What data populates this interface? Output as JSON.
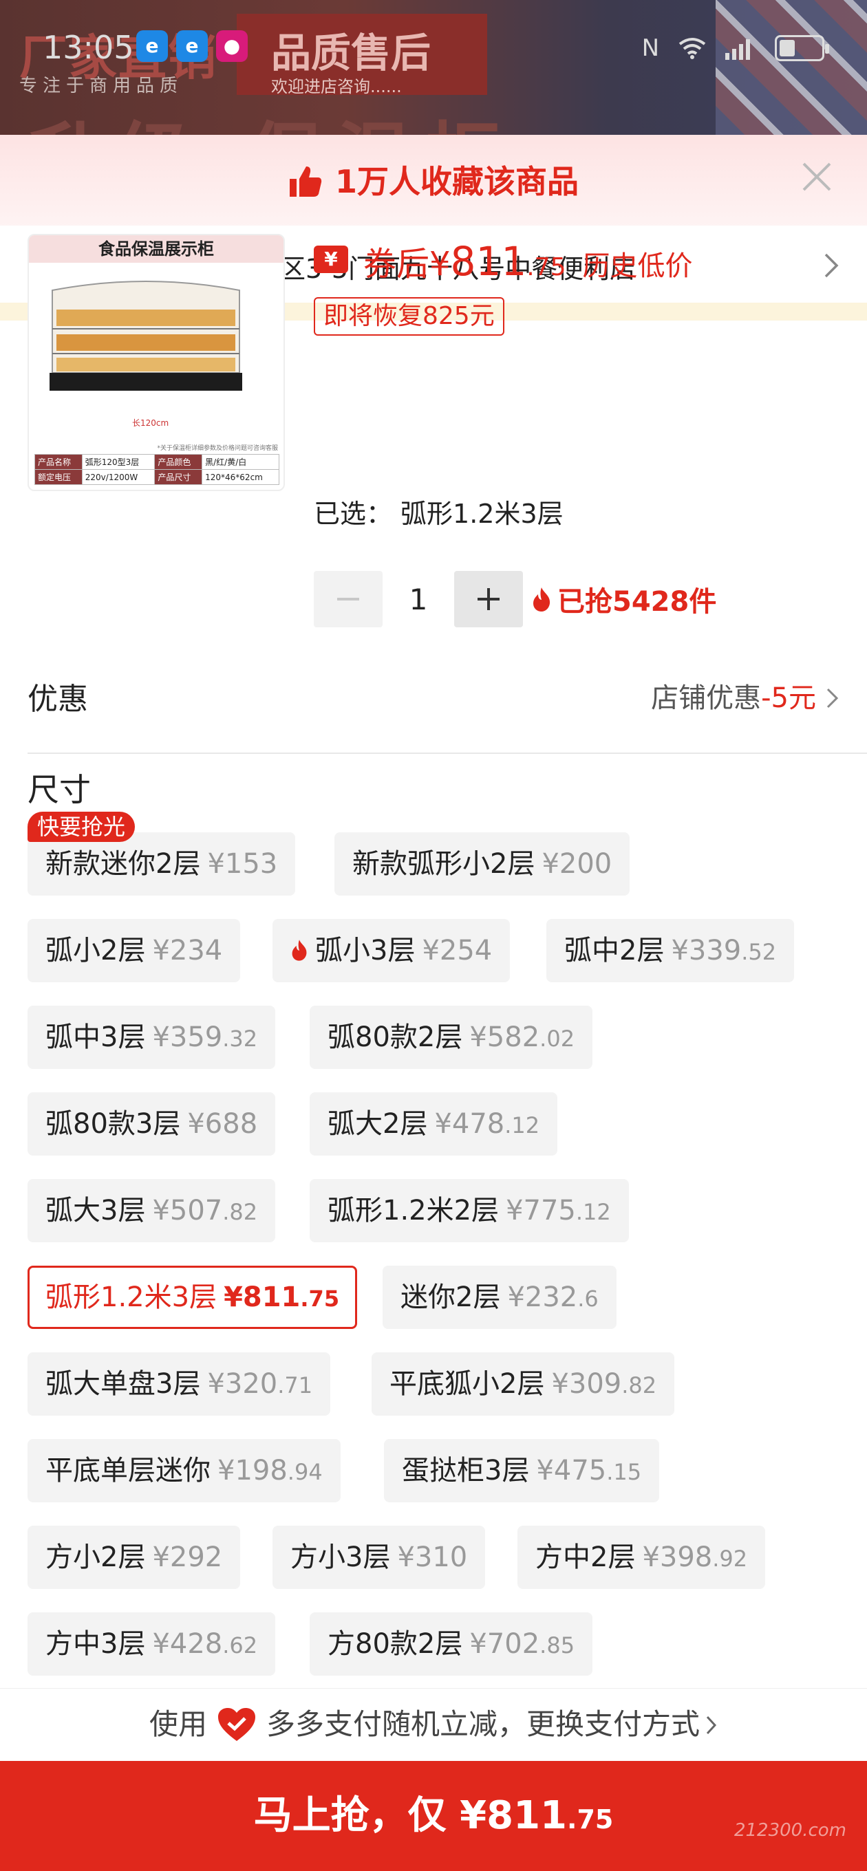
{
  "background": {
    "brand": "厂家直销",
    "slogan": "专注于商用品质",
    "banner_title": "品质售后",
    "banner_sub": "欢迎进店咨询......",
    "big_text": "升级 保温柜"
  },
  "status_bar": {
    "time": "13:05"
  },
  "favorites": {
    "text": "1万人收藏该商品"
  },
  "address": {
    "text": "徐莎，嘉慧新城小区3-5门面九十八号中餐便利店"
  },
  "product": {
    "image_title": "食品保温展示柜",
    "image_length": "长120cm",
    "image_note": "*关于保温柜详细参数及价格问题可咨询客服",
    "image_specs": [
      [
        "产品名称",
        "弧形120型3层",
        "产品颜色",
        "黑/红/黄/白"
      ],
      [
        "额定电压",
        "220v/1200W",
        "产品尺寸",
        "120*46*62cm"
      ]
    ],
    "coupon_icon": "¥",
    "price_label": "券后¥",
    "price_int": "811",
    "price_dec": ".75",
    "history_tag": "历史低价",
    "restore_text": "即将恢复825元",
    "selected_label": "已选：",
    "selected_value": "弧形1.2米3层",
    "quantity": "1",
    "sold_text": "已抢5428件"
  },
  "promo": {
    "label": "优惠",
    "shop_label": "店铺优惠",
    "discount": "-5元"
  },
  "sizes": {
    "label": "尺寸",
    "hot_tag": "快要抢光",
    "options": [
      {
        "name": "新款迷你2层",
        "price": "¥153",
        "dec": ""
      },
      {
        "name": "新款弧形小2层",
        "price": "¥200",
        "dec": ""
      },
      {
        "name": "弧小2层",
        "price": "¥234",
        "dec": ""
      },
      {
        "name": "弧小3层",
        "price": "¥254",
        "dec": ""
      },
      {
        "name": "弧中2层",
        "price": "¥339",
        "dec": ".52"
      },
      {
        "name": "弧中3层",
        "price": "¥359",
        "dec": ".32"
      },
      {
        "name": "弧80款2层",
        "price": "¥582",
        "dec": ".02"
      },
      {
        "name": "弧80款3层",
        "price": "¥688",
        "dec": ""
      },
      {
        "name": "弧大2层",
        "price": "¥478",
        "dec": ".12"
      },
      {
        "name": "弧大3层",
        "price": "¥507",
        "dec": ".82"
      },
      {
        "name": "弧形1.2米2层",
        "price": "¥775",
        "dec": ".12"
      },
      {
        "name": "弧形1.2米3层",
        "price": "¥811",
        "dec": ".75"
      },
      {
        "name": "迷你2层",
        "price": "¥232",
        "dec": ".6"
      },
      {
        "name": "弧大单盘3层",
        "price": "¥320",
        "dec": ".71"
      },
      {
        "name": "平底狐小2层",
        "price": "¥309",
        "dec": ".82"
      },
      {
        "name": "平底单层迷你",
        "price": "¥198",
        "dec": ".94"
      },
      {
        "name": "蛋挞柜3层",
        "price": "¥475",
        "dec": ".15"
      },
      {
        "name": "方小2层",
        "price": "¥292",
        "dec": ""
      },
      {
        "name": "方小3层",
        "price": "¥310",
        "dec": ""
      },
      {
        "name": "方中2层",
        "price": "¥398",
        "dec": ".92"
      },
      {
        "name": "方中3层",
        "price": "¥428",
        "dec": ".62"
      },
      {
        "name": "方80款2层",
        "price": "¥702",
        "dec": ".85"
      }
    ]
  },
  "payment": {
    "use": "使用",
    "text": "多多支付随机立减，更换支付方式"
  },
  "buy": {
    "label": "马上抢，仅 ¥811",
    "dec": ".75"
  },
  "watermark": "212300.com",
  "colors": {
    "accent": "#e0281c",
    "chip_bg": "#f3f3f3",
    "muted": "#999999"
  }
}
